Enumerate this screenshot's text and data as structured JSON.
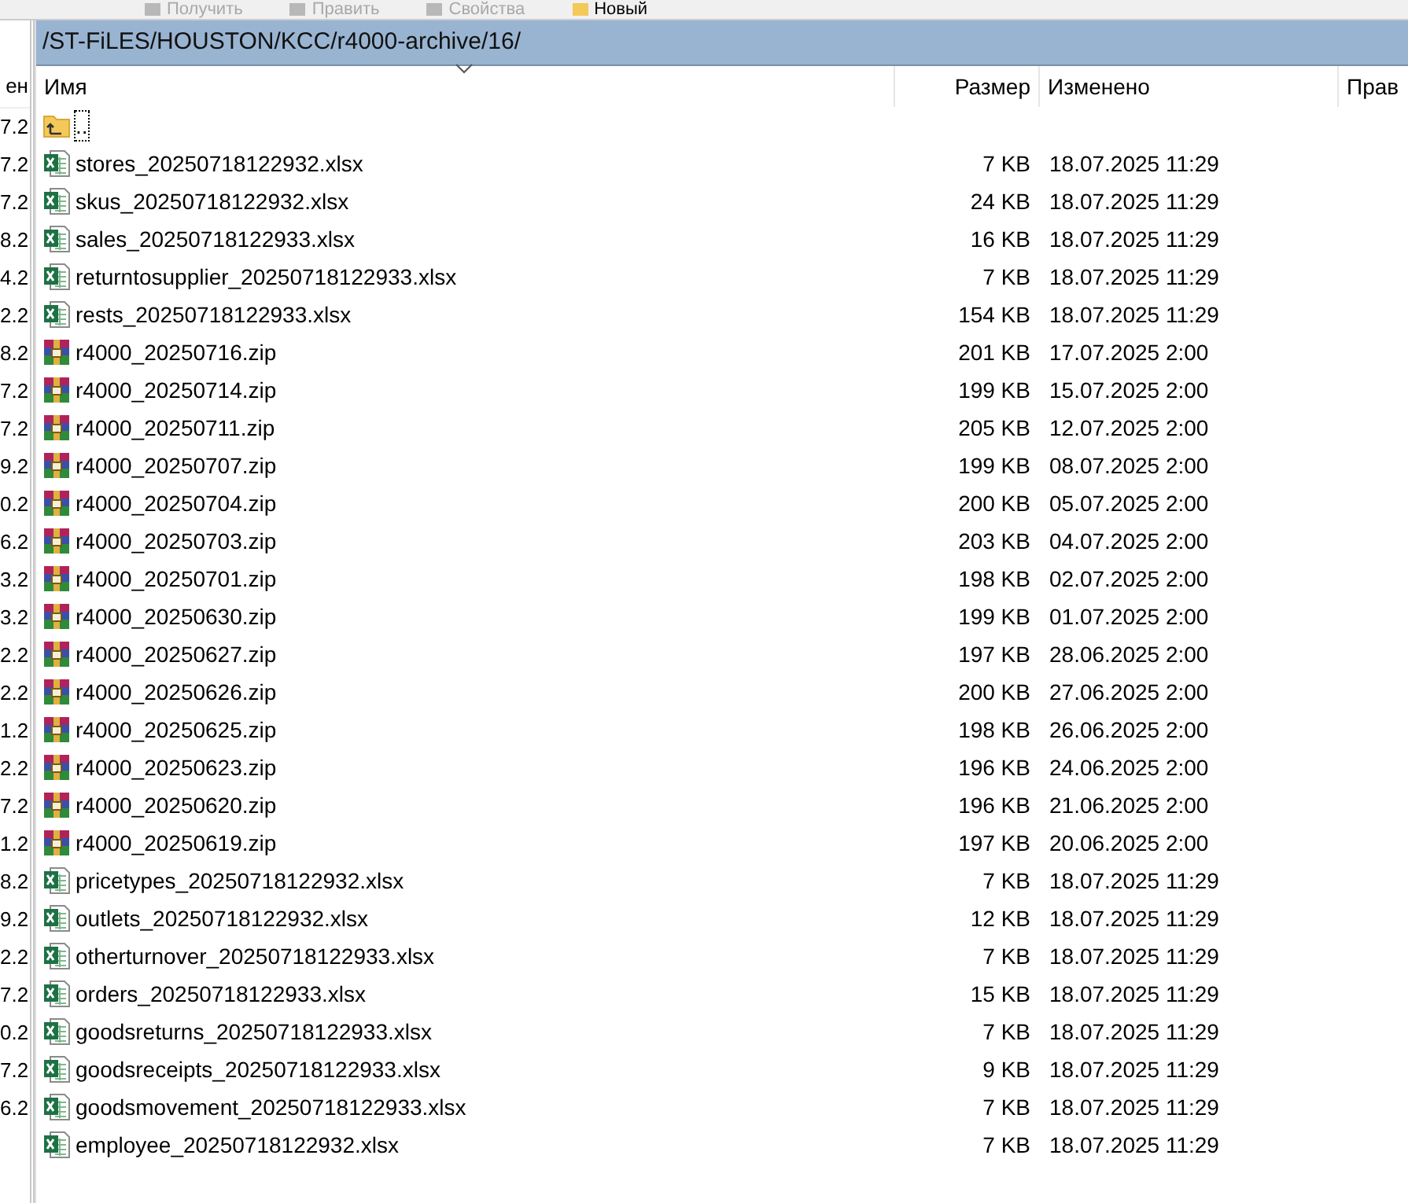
{
  "toolbar": [
    {
      "label": "Получить",
      "disabled": true
    },
    {
      "label": "Править",
      "disabled": true
    },
    {
      "label": "Свойства",
      "disabled": true
    },
    {
      "label": "Новый",
      "disabled": false
    }
  ],
  "left_panel": {
    "column_header": "ен",
    "values": [
      "7.2",
      "7.2",
      "7.2",
      "8.2",
      "4.2",
      "2.2",
      "8.2",
      "7.2",
      "7.2",
      "9.2",
      "0.2",
      "6.2",
      "3.2",
      "3.2",
      "2.2",
      "2.2",
      "1.2",
      "2.2",
      "7.2",
      "1.2",
      "8.2",
      "9.2",
      "2.2",
      "7.2",
      "0.2",
      "7.2",
      "6.2"
    ]
  },
  "path": "/ST-FiLES/HOUSTON/KCC/r4000-archive/16/",
  "columns": [
    "Имя",
    "Размер",
    "Изменено",
    "Прав"
  ],
  "files": [
    {
      "kind": "parent",
      "name": "..",
      "selected": true
    },
    {
      "kind": "xlsx",
      "name": "stores_20250718122932.xlsx",
      "size": "7 KB",
      "modified": "18.07.2025 11:29",
      "selected": false
    },
    {
      "kind": "xlsx",
      "name": "skus_20250718122932.xlsx",
      "size": "24 KB",
      "modified": "18.07.2025 11:29",
      "selected": false
    },
    {
      "kind": "xlsx",
      "name": "sales_20250718122933.xlsx",
      "size": "16 KB",
      "modified": "18.07.2025 11:29",
      "selected": false
    },
    {
      "kind": "xlsx",
      "name": "returntosupplier_20250718122933.xlsx",
      "size": "7 KB",
      "modified": "18.07.2025 11:29",
      "selected": false
    },
    {
      "kind": "xlsx",
      "name": "rests_20250718122933.xlsx",
      "size": "154 KB",
      "modified": "18.07.2025 11:29",
      "selected": false
    },
    {
      "kind": "zip",
      "name": "r4000_20250716.zip",
      "size": "201 KB",
      "modified": "17.07.2025 2:00",
      "selected": false
    },
    {
      "kind": "zip",
      "name": "r4000_20250714.zip",
      "size": "199 KB",
      "modified": "15.07.2025 2:00",
      "selected": false
    },
    {
      "kind": "zip",
      "name": "r4000_20250711.zip",
      "size": "205 KB",
      "modified": "12.07.2025 2:00",
      "selected": false
    },
    {
      "kind": "zip",
      "name": "r4000_20250707.zip",
      "size": "199 KB",
      "modified": "08.07.2025 2:00",
      "selected": false
    },
    {
      "kind": "zip",
      "name": "r4000_20250704.zip",
      "size": "200 KB",
      "modified": "05.07.2025 2:00",
      "selected": false
    },
    {
      "kind": "zip",
      "name": "r4000_20250703.zip",
      "size": "203 KB",
      "modified": "04.07.2025 2:00",
      "selected": false
    },
    {
      "kind": "zip",
      "name": "r4000_20250701.zip",
      "size": "198 KB",
      "modified": "02.07.2025 2:00",
      "selected": false
    },
    {
      "kind": "zip",
      "name": "r4000_20250630.zip",
      "size": "199 KB",
      "modified": "01.07.2025 2:00",
      "selected": false
    },
    {
      "kind": "zip",
      "name": "r4000_20250627.zip",
      "size": "197 KB",
      "modified": "28.06.2025 2:00",
      "selected": false
    },
    {
      "kind": "zip",
      "name": "r4000_20250626.zip",
      "size": "200 KB",
      "modified": "27.06.2025 2:00",
      "selected": false
    },
    {
      "kind": "zip",
      "name": "r4000_20250625.zip",
      "size": "198 KB",
      "modified": "26.06.2025 2:00",
      "selected": false
    },
    {
      "kind": "zip",
      "name": "r4000_20250623.zip",
      "size": "196 KB",
      "modified": "24.06.2025 2:00",
      "selected": false
    },
    {
      "kind": "zip",
      "name": "r4000_20250620.zip",
      "size": "196 KB",
      "modified": "21.06.2025 2:00",
      "selected": false
    },
    {
      "kind": "zip",
      "name": "r4000_20250619.zip",
      "size": "197 KB",
      "modified": "20.06.2025 2:00",
      "selected": false
    },
    {
      "kind": "xlsx",
      "name": "pricetypes_20250718122932.xlsx",
      "size": "7 KB",
      "modified": "18.07.2025 11:29",
      "selected": false
    },
    {
      "kind": "xlsx",
      "name": "outlets_20250718122932.xlsx",
      "size": "12 KB",
      "modified": "18.07.2025 11:29",
      "selected": false
    },
    {
      "kind": "xlsx",
      "name": "otherturnover_20250718122933.xlsx",
      "size": "7 KB",
      "modified": "18.07.2025 11:29",
      "selected": false
    },
    {
      "kind": "xlsx",
      "name": "orders_20250718122933.xlsx",
      "size": "15 KB",
      "modified": "18.07.2025 11:29",
      "selected": false
    },
    {
      "kind": "xlsx",
      "name": "goodsreturns_20250718122933.xlsx",
      "size": "7 KB",
      "modified": "18.07.2025 11:29",
      "selected": false
    },
    {
      "kind": "xlsx",
      "name": "goodsreceipts_20250718122933.xlsx",
      "size": "9 KB",
      "modified": "18.07.2025 11:29",
      "selected": false
    },
    {
      "kind": "xlsx",
      "name": "goodsmovement_20250718122933.xlsx",
      "size": "7 KB",
      "modified": "18.07.2025 11:29",
      "selected": false
    },
    {
      "kind": "xlsx",
      "name": "employee_20250718122932.xlsx",
      "size": "7 KB",
      "modified": "18.07.2025 11:29",
      "selected": false
    }
  ]
}
